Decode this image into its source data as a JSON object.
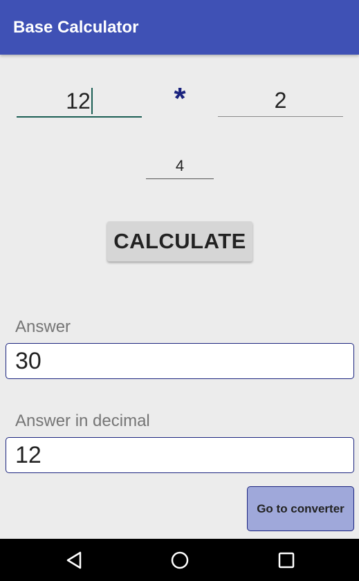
{
  "app_bar": {
    "title": "Base Calculator",
    "color": "#3f51b5"
  },
  "calculator": {
    "operand1": "12",
    "operator": "*",
    "operand2": "2",
    "base": "4",
    "calculate_label": "CALCULATE"
  },
  "results": {
    "answer_label": "Answer",
    "answer_value": "30",
    "decimal_label": "Answer in decimal",
    "decimal_value": "12"
  },
  "converter_button": {
    "label": "Go to converter",
    "color": "#9fa8da"
  },
  "nav_bar": {
    "icons": [
      "back-icon",
      "home-icon",
      "recents-icon"
    ]
  }
}
